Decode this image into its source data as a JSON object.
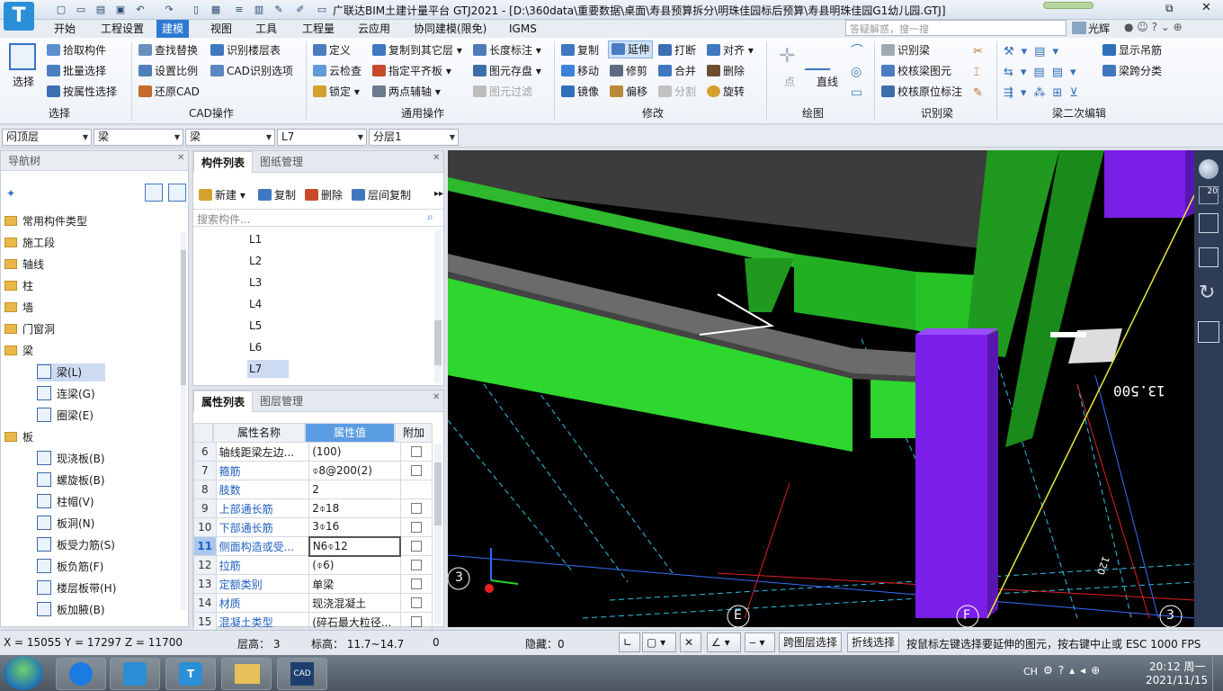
{
  "titlebar": {
    "title": "广联达BIM土建计量平台 GTJ2021 - [D:\\360data\\重要数据\\桌面\\寿县预算拆分\\明珠佳园标后预算\\寿县明珠佳园G1幼儿园.GTJ]",
    "search_placeholder": "答疑解惑，搜一搜",
    "user": "光辉"
  },
  "menu": [
    "开始",
    "工程设置",
    "建模",
    "视图",
    "工具",
    "工程量",
    "云应用",
    "协同建模(限免)",
    "IGMS"
  ],
  "menu_active": "建模",
  "ribbon": {
    "select": {
      "big": "选择",
      "items": [
        "拾取构件",
        "批量选择",
        "按属性选择"
      ],
      "group": "选择"
    },
    "cad": {
      "items": [
        "查找替换",
        "设置比例",
        "还原CAD",
        "识别楼层表",
        "CAD识别选项"
      ],
      "group": "CAD操作"
    },
    "common": {
      "items": [
        "定义",
        "云检查",
        "锁定",
        "复制到其它层",
        "指定平齐板",
        "两点辅轴",
        "长度标注",
        "图元存盘",
        "图元过滤"
      ],
      "group": "通用操作"
    },
    "modify": {
      "items": [
        "复制",
        "移动",
        "镜像",
        "延伸",
        "修剪",
        "偏移",
        "打断",
        "合并",
        "分割",
        "对齐",
        "删除",
        "旋转"
      ],
      "group": "修改"
    },
    "draw": {
      "items": [
        "点",
        "直线"
      ],
      "group": "绘图"
    },
    "recognize": {
      "items": [
        "识别梁",
        "校核梁图元",
        "校核原位标注"
      ],
      "group": "识别梁"
    },
    "beam2": {
      "items": [
        "显示吊筋",
        "梁跨分类"
      ],
      "group": "梁二次编辑"
    }
  },
  "selectors": [
    "闷顶层",
    "梁",
    "梁",
    "L7",
    "分层1"
  ],
  "navtree": {
    "title": "导航树",
    "items": [
      {
        "label": "常用构件类型",
        "type": "folder"
      },
      {
        "label": "施工段",
        "type": "folder"
      },
      {
        "label": "轴线",
        "type": "folder"
      },
      {
        "label": "柱",
        "type": "folder"
      },
      {
        "label": "墙",
        "type": "folder"
      },
      {
        "label": "门窗洞",
        "type": "folder"
      },
      {
        "label": "梁",
        "type": "folder-open"
      },
      {
        "label": "梁(L)",
        "type": "child",
        "selected": true
      },
      {
        "label": "连梁(G)",
        "type": "child"
      },
      {
        "label": "圈梁(E)",
        "type": "child"
      },
      {
        "label": "板",
        "type": "folder-open"
      },
      {
        "label": "现浇板(B)",
        "type": "child"
      },
      {
        "label": "螺旋板(B)",
        "type": "child"
      },
      {
        "label": "柱帽(V)",
        "type": "child"
      },
      {
        "label": "板洞(N)",
        "type": "child"
      },
      {
        "label": "板受力筋(S)",
        "type": "child"
      },
      {
        "label": "板负筋(F)",
        "type": "child"
      },
      {
        "label": "楼层板带(H)",
        "type": "child"
      },
      {
        "label": "板加腋(B)",
        "type": "child"
      }
    ]
  },
  "complist": {
    "tabs": [
      "构件列表",
      "图纸管理"
    ],
    "toolbar": [
      "新建",
      "复制",
      "删除",
      "层间复制"
    ],
    "search_placeholder": "搜索构件...",
    "items": [
      "L1",
      "L2",
      "L3",
      "L4",
      "L5",
      "L6",
      "L7"
    ],
    "selected": "L7"
  },
  "proplist": {
    "tabs": [
      "属性列表",
      "图层管理"
    ],
    "headers": [
      "属性名称",
      "属性值",
      "附加"
    ],
    "rows": [
      {
        "n": "6",
        "k": "轴线距梁左边...",
        "v": "(100)",
        "blue": false,
        "cb": true
      },
      {
        "n": "7",
        "k": "箍筋",
        "v": "⌽8@200(2)",
        "blue": true,
        "cb": true
      },
      {
        "n": "8",
        "k": "肢数",
        "v": "2",
        "blue": true,
        "cb": false
      },
      {
        "n": "9",
        "k": "上部通长筋",
        "v": "2⌽18",
        "blue": true,
        "cb": true
      },
      {
        "n": "10",
        "k": "下部通长筋",
        "v": "3⌽16",
        "blue": true,
        "cb": true
      },
      {
        "n": "11",
        "k": "侧面构造或受...",
        "v": "N6⌽12",
        "blue": true,
        "cb": true
      },
      {
        "n": "12",
        "k": "拉筋",
        "v": "(⌽6)",
        "blue": true,
        "cb": true
      },
      {
        "n": "13",
        "k": "定额类别",
        "v": "单梁",
        "blue": true,
        "cb": true
      },
      {
        "n": "14",
        "k": "材质",
        "v": "现浇混凝土",
        "blue": true,
        "cb": true
      },
      {
        "n": "15",
        "k": "混凝土类型",
        "v": "(碎石最大粒径...",
        "blue": true,
        "cb": true
      }
    ]
  },
  "viewport": {
    "elevation_label": "13.500",
    "axis_labels": [
      "3",
      "E",
      "F",
      "3"
    ],
    "dim_label": "120"
  },
  "status": {
    "coords": "X = 15055 Y = 17297 Z = 11700",
    "floor_height": "层高：  3",
    "elevation": "标高：  11.7~14.7",
    "zero": "0",
    "hidden": "隐藏：0",
    "btn_cross_floor": "跨图层选择",
    "btn_polyline": "折线选择",
    "hint": "按鼠标左键选择要延伸的图元，按右键中止或 ESC 1000 FPS"
  },
  "taskbar": {
    "time": "20:12 周一",
    "date": "2021/11/15",
    "lang": "CH"
  }
}
